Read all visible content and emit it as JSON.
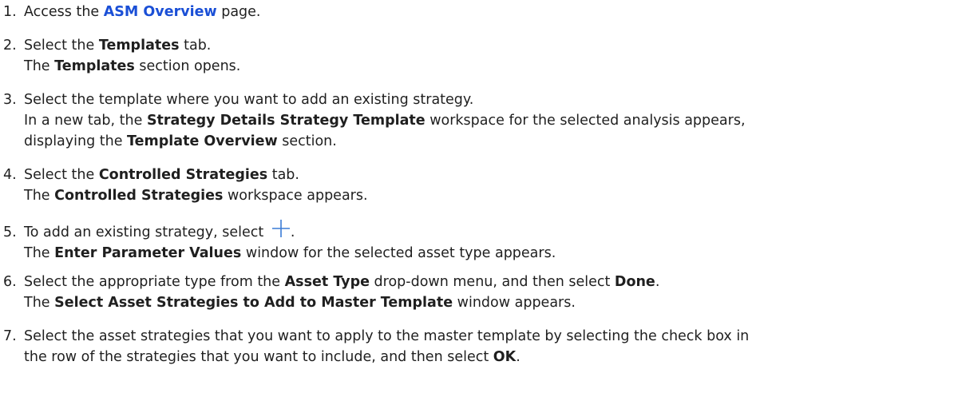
{
  "steps": [
    {
      "number": "1.",
      "pre": "Access the ",
      "link": "ASM Overview",
      "post": " page."
    },
    {
      "number": "2.",
      "pre": "Select the ",
      "bold": "Templates",
      "post": " tab.",
      "result_bold": "Templates",
      "result_post": " section opens."
    },
    {
      "number": "3.",
      "text": "Select the template where you want to add an existing strategy.",
      "result_pre": "In a new tab, the ",
      "result_bold": "Strategy Details Strategy Template",
      "result_post": " workspace for the selected analysis appears,",
      "result2_pre": "displaying the ",
      "result2_bold": "Template Overview",
      "result2_post": " section."
    },
    {
      "number": "4.",
      "pre": "Select the ",
      "bold": "Controlled Strategies",
      "post": " tab.",
      "result_bold": "Controlled Strategies",
      "result_post": " workspace appears."
    },
    {
      "number": "5.",
      "pre": "To add an existing strategy, select ",
      "icon": "plus-icon",
      "post": ".",
      "result_bold": "Enter Parameter Values",
      "result_post": " window for the selected asset type appears."
    },
    {
      "number": "6.",
      "pre": "Select the appropriate type from the ",
      "bold": "Asset Type",
      "mid": " drop-down menu, and then select ",
      "bold2": "Done",
      "post": ".",
      "result_bold": "Select Asset Strategies to Add to Master Template",
      "result_post": " window appears."
    },
    {
      "number": "7.",
      "text": "Select the asset strategies that you want to apply to the master template by selecting the check box in",
      "cont_pre": "the row of the strategies that you want to include, and then select ",
      "cont_bold": "OK",
      "cont_post": "."
    }
  ],
  "result_article": "The ",
  "colors": {
    "link": "#1a4fd6",
    "icon": "#3a7bd5",
    "text": "#1f1f1f"
  }
}
